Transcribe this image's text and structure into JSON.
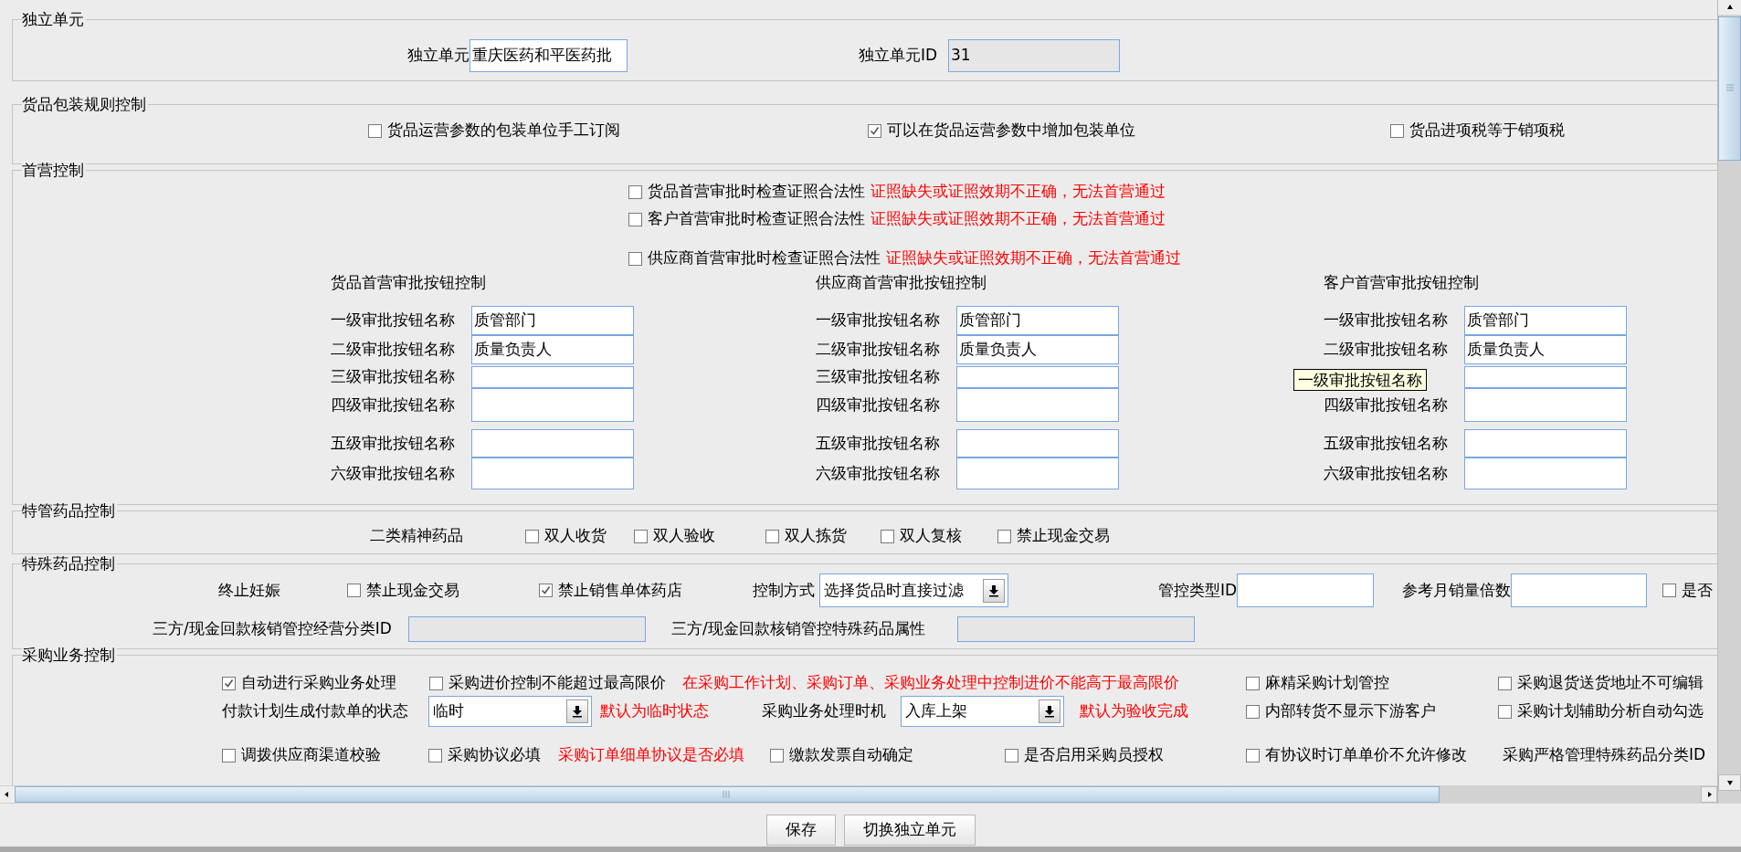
{
  "sections": [
    {
      "title": "独立单元",
      "rows": [
        {
          "items": [
            {
              "kind": "text",
              "text": "独立单元"
            },
            {
              "kind": "field",
              "value": "重庆医药和平医药批",
              "disabled": false
            },
            {
              "kind": "text",
              "text": "独立单元ID"
            },
            {
              "kind": "field",
              "value": "31",
              "disabled": true
            }
          ]
        }
      ]
    },
    {
      "title": "货品包装规则控制",
      "rows": [
        {
          "items": [
            {
              "kind": "checkbox",
              "label": "货品运营参数的包装单位手工订阅",
              "checked": false
            },
            {
              "kind": "checkbox",
              "label": "可以在货品运营参数中增加包装单位",
              "checked": true
            },
            {
              "kind": "checkbox",
              "label": "货品进项税等于销项税",
              "checked": false
            }
          ]
        }
      ]
    },
    {
      "title": "首营控制",
      "rows": [
        {
          "items": [
            {
              "kind": "checkbox",
              "label": "货品首营审批时检查证照合法性",
              "checked": false,
              "note": "证照缺失或证照效期不正确，无法首营通过"
            }
          ]
        },
        {
          "items": [
            {
              "kind": "checkbox",
              "label": "客户首营审批时检查证照合法性",
              "checked": false,
              "note": "证照缺失或证照效期不正确，无法首营通过"
            }
          ]
        },
        {
          "items": [
            {
              "kind": "checkbox",
              "label": "供应商首营审批时检查证照合法性",
              "checked": false,
              "note": "证照缺失或证照效期不正确，无法首营通过"
            }
          ]
        }
      ],
      "groups": [
        {
          "title": "货品首营审批按钮控制",
          "rows": [
            {
              "label": "一级审批按钮名称",
              "value": "质管部门"
            },
            {
              "label": "二级审批按钮名称",
              "value": "质量负责人"
            },
            {
              "label": "三级审批按钮名称"
            },
            {
              "label": "四级审批按钮名称"
            },
            {
              "label": "五级审批按钮名称"
            },
            {
              "label": "六级审批按钮名称"
            }
          ]
        },
        {
          "title": "供应商首营审批按钮控制",
          "rows": [
            {
              "label": "一级审批按钮名称",
              "value": "质管部门"
            },
            {
              "label": "二级审批按钮名称",
              "value": "质量负责人"
            },
            {
              "label": "三级审批按钮名称"
            },
            {
              "label": "四级审批按钮名称"
            },
            {
              "label": "五级审批按钮名称"
            },
            {
              "label": "六级审批按钮名称"
            }
          ]
        },
        {
          "title": "客户首营审批按钮控制",
          "rows": [
            {
              "label": "一级审批按钮名称",
              "value": "质管部门"
            },
            {
              "label": "二级审批按钮名称",
              "value": "质量负责人"
            },
            {},
            {
              "label": "四级审批按钮名称"
            },
            {
              "label": "五级审批按钮名称"
            },
            {
              "label": "六级审批按钮名称"
            }
          ],
          "tooltip": "一级审批按钮名称"
        }
      ]
    },
    {
      "title": "特管药品控制",
      "rows": [
        {
          "items": [
            {
              "kind": "text",
              "text": "二类精神药品"
            },
            {
              "kind": "checkbox",
              "label": "双人收货",
              "checked": false
            },
            {
              "kind": "checkbox",
              "label": "双人验收",
              "checked": false
            },
            {
              "kind": "checkbox",
              "label": "双人拣货",
              "checked": false
            },
            {
              "kind": "checkbox",
              "label": "双人复核",
              "checked": false
            },
            {
              "kind": "checkbox",
              "label": "禁止现金交易",
              "checked": false
            }
          ]
        }
      ]
    },
    {
      "title": "特殊药品控制",
      "rows": [
        {
          "items": [
            {
              "kind": "text",
              "text": "终止妊娠"
            },
            {
              "kind": "checkbox",
              "label": "禁止现金交易",
              "checked": false
            },
            {
              "kind": "checkbox",
              "label": "禁止销售单体药店",
              "checked": true
            },
            {
              "kind": "text",
              "text": "控制方式"
            },
            {
              "kind": "combo",
              "value": "选择货品时直接过滤"
            },
            {
              "kind": "text",
              "text": "管控类型ID"
            },
            {
              "kind": "field",
              "disabled": false
            },
            {
              "kind": "text",
              "text": "参考月销量倍数"
            },
            {
              "kind": "field",
              "disabled": false
            },
            {
              "kind": "checkbox",
              "label": "是否",
              "checked": false
            }
          ]
        },
        {
          "items": [
            {
              "kind": "text",
              "text": "三方/现金回款核销管控经营分类ID"
            },
            {
              "kind": "field",
              "disabled": true
            },
            {
              "kind": "text",
              "text": "三方/现金回款核销管控特殊药品属性"
            },
            {
              "kind": "field",
              "disabled": true
            }
          ]
        }
      ]
    },
    {
      "title": "采购业务控制",
      "rows": [
        {
          "items": [
            {
              "kind": "checkbox",
              "label": "自动进行采购业务处理",
              "checked": true
            },
            {
              "kind": "checkbox",
              "label": "采购进价控制不能超过最高限价",
              "checked": false
            },
            {
              "kind": "note",
              "text": "在采购工作计划、采购订单、采购业务处理中控制进价不能高于最高限价"
            },
            {
              "kind": "checkbox",
              "label": "麻精采购计划管控",
              "checked": false
            },
            {
              "kind": "checkbox",
              "label": "采购退货送货地址不可编辑",
              "checked": false
            }
          ]
        },
        {
          "items": [
            {
              "kind": "text",
              "text": "付款计划生成付款单的状态"
            },
            {
              "kind": "combo",
              "value": "临时"
            },
            {
              "kind": "note",
              "text": "默认为临时状态"
            },
            {
              "kind": "text",
              "text": "采购业务处理时机"
            },
            {
              "kind": "combo",
              "value": "入库上架"
            },
            {
              "kind": "note",
              "text": "默认为验收完成"
            },
            {
              "kind": "checkbox",
              "label": "内部转货不显示下游客户",
              "checked": false
            },
            {
              "kind": "checkbox",
              "label": "采购计划辅助分析自动勾选",
              "checked": false
            }
          ]
        },
        {
          "items": [
            {
              "kind": "checkbox",
              "label": "调拨供应商渠道校验",
              "checked": false
            },
            {
              "kind": "checkbox",
              "label": "采购协议必填",
              "checked": false
            },
            {
              "kind": "note",
              "text": "采购订单细单协议是否必填"
            },
            {
              "kind": "checkbox",
              "label": "缴款发票自动确定",
              "checked": false
            },
            {
              "kind": "checkbox",
              "label": "是否启用采购员授权",
              "checked": false
            },
            {
              "kind": "checkbox",
              "label": "有协议时订单单价不允许修改",
              "checked": false
            },
            {
              "kind": "text",
              "text": "采购严格管理特殊药品分类ID"
            }
          ]
        }
      ]
    }
  ],
  "buttons": [
    "保存",
    "切换独立单元"
  ]
}
